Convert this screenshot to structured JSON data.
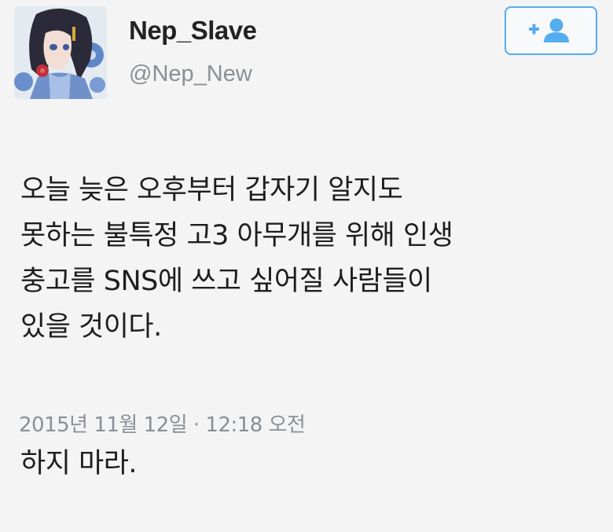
{
  "user": {
    "display_name": "Nep_Slave",
    "handle": "@Nep_New",
    "avatar_icon": "anime-avatar"
  },
  "follow_button": {
    "icon": "follow-user-icon",
    "accent_color": "#55acee"
  },
  "tweet": {
    "paragraph_1": "오늘 늦은 오후부터 갑자기 알지도\n못하는 불특정 고3 아무개를 위해 인생\n충고를 SNS에 쓰고 싶어질 사람들이\n있을 것이다.",
    "paragraph_2": "하지 마라.",
    "timestamp": "2015년 11월 12일 · 12:18 오전"
  }
}
